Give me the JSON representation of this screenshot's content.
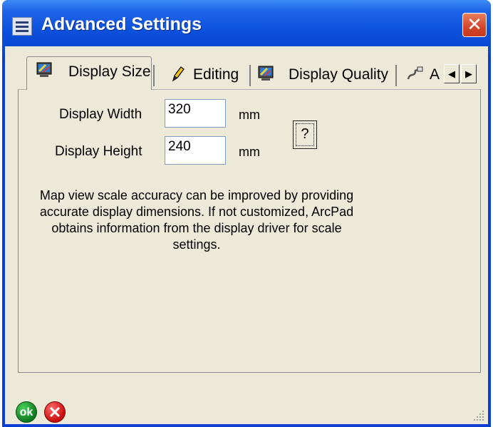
{
  "window": {
    "title": "Advanced Settings",
    "title_icon": "settings-icon",
    "close_icon": "close-icon",
    "close_glyph": "✕"
  },
  "tabs": [
    {
      "label": "Display Size",
      "icon": "monitor-icon",
      "active": true
    },
    {
      "label": "Editing",
      "icon": "pencil-icon",
      "active": false
    },
    {
      "label": "Display Quality",
      "icon": "monitor-icon",
      "active": false
    },
    {
      "label": "A",
      "icon": "cable-icon",
      "active": false
    }
  ],
  "tab_scroll": {
    "left_glyph": "◀",
    "right_glyph": "▶"
  },
  "display_width": {
    "label": "Display Width",
    "value": "320",
    "unit": "mm"
  },
  "display_height": {
    "label": "Display Height",
    "value": "240",
    "unit": "mm"
  },
  "help_button": {
    "label": "?"
  },
  "description": "Map view scale accuracy can be improved by providing accurate display dimensions. If not customized, ArcPad obtains information from the display driver for scale settings.",
  "footer": {
    "ok_label": "ok",
    "cancel_glyph": "✕"
  },
  "colors": {
    "titlebar": "#0b4fdb",
    "client_bg": "#ece9d8",
    "close": "#d5452a",
    "ok": "#0f7a1f",
    "cancel": "#c80b0b"
  }
}
